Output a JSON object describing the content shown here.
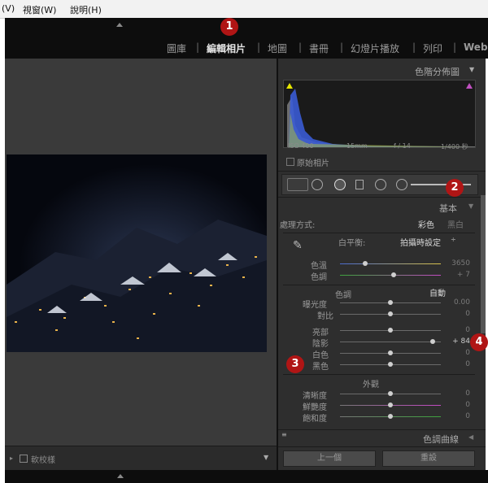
{
  "menu": {
    "view_partial": "(V)",
    "window": "視窗(W)",
    "help": "說明(H)"
  },
  "modules": [
    "圖庫",
    "編輯相片",
    "地圖",
    "書冊",
    "幻燈片播放",
    "列印",
    "Web"
  ],
  "module_separator": "|",
  "callouts": [
    "1",
    "2",
    "3",
    "4"
  ],
  "histogram": {
    "title": "色階分佈圖",
    "iso": "ISO 400",
    "focal": "15mm",
    "aperture": "f / 14",
    "shutter": "1/400 秒",
    "original_photo_label": "原始相片"
  },
  "basic": {
    "title": "基本",
    "treatment_label": "處理方式:",
    "color_option": "彩色",
    "bw_option": "黑白",
    "wb_label": "白平衡:",
    "wb_value": "拍攝時設定",
    "temp_label": "色溫",
    "temp_value": "3650",
    "temp_level": 0.25,
    "tint_label": "色調",
    "tint_value": "+ 7",
    "tint_level": 0.53,
    "tone_label": "色調",
    "auto_label": "自動",
    "exposure_label": "曝光度",
    "exposure_value": "0.00",
    "contrast_label": "對比",
    "contrast_value": "0",
    "highlights_label": "亮部",
    "highlights_value": "0",
    "shadows_label": "陰影",
    "shadows_value": "+ 84",
    "shadows_level": 0.92,
    "whites_label": "白色",
    "whites_value": "0",
    "blacks_label": "黑色",
    "blacks_value": "0",
    "presence_label": "外觀",
    "clarity_label": "清晰度",
    "clarity_value": "0",
    "vibrance_label": "鮮艷度",
    "vibrance_value": "0",
    "saturation_label": "飽和度",
    "saturation_value": "0"
  },
  "tone_curve_title": "色調曲線",
  "buttons": {
    "previous": "上一個",
    "reset": "重設"
  },
  "soft_proof_label": "軟校樣",
  "colors": {
    "accent_red": "#b01515",
    "panel_bg": "#2e2e2e"
  }
}
